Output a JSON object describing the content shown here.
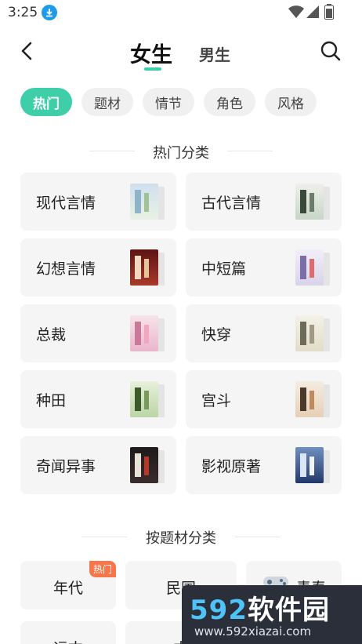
{
  "status_bar": {
    "time": "3:25"
  },
  "header": {
    "tab_female": "女生",
    "tab_male": "男生"
  },
  "filters": [
    {
      "label": "热门",
      "active": true
    },
    {
      "label": "题材",
      "active": false
    },
    {
      "label": "情节",
      "active": false
    },
    {
      "label": "角色",
      "active": false
    },
    {
      "label": "风格",
      "active": false
    }
  ],
  "hot_section": {
    "title": "热门分类",
    "categories": [
      {
        "label": "现代言情",
        "cover_color": "#d7e4f0"
      },
      {
        "label": "古代言情",
        "cover_color": "#dfe6e0"
      },
      {
        "label": "幻想言情",
        "cover_color": "#7a1f1f"
      },
      {
        "label": "中短篇",
        "cover_color": "#e8e4f2"
      },
      {
        "label": "总裁",
        "cover_color": "#f3d6e2"
      },
      {
        "label": "快穿",
        "cover_color": "#eeeade"
      },
      {
        "label": "种田",
        "cover_color": "#dce8d0"
      },
      {
        "label": "宫斗",
        "cover_color": "#f1e6da"
      },
      {
        "label": "奇闻异事",
        "cover_color": "#2a2222"
      },
      {
        "label": "影视原著",
        "cover_color": "#2f4a7a"
      }
    ]
  },
  "subject_section": {
    "title": "按题材分类",
    "row1": [
      {
        "label": "年代",
        "badge": "热门"
      },
      {
        "label": "民国",
        "badge": ""
      },
      {
        "label": "青春",
        "badge": ""
      }
    ],
    "row2": [
      {
        "label": "远古"
      },
      {
        "label": "古"
      },
      {
        "label": ""
      }
    ]
  },
  "watermark": {
    "brand_num": "592",
    "brand_cn": "软件园",
    "url": "www.592xiazai.com"
  },
  "colors": {
    "accent": "#3ecfa8",
    "hot_badge": "#f7774a",
    "card_bg": "#f5f5f5"
  }
}
